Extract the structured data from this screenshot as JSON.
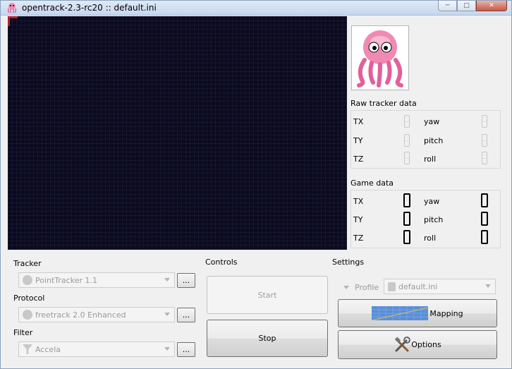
{
  "window": {
    "title": "opentrack-2.3-rc20 :: default.ini"
  },
  "raw_tracker": {
    "title": "Raw tracker data",
    "rows": [
      {
        "left_label": "TX",
        "right_label": "yaw"
      },
      {
        "left_label": "TY",
        "right_label": "pitch"
      },
      {
        "left_label": "TZ",
        "right_label": "roll"
      }
    ]
  },
  "game_data": {
    "title": "Game data",
    "rows": [
      {
        "left_label": "TX",
        "left_value": "0",
        "right_label": "yaw",
        "right_value": "0"
      },
      {
        "left_label": "TY",
        "left_value": "0",
        "right_label": "pitch",
        "right_value": "0"
      },
      {
        "left_label": "TZ",
        "left_value": "0",
        "right_label": "roll",
        "right_value": "0"
      }
    ]
  },
  "modules": {
    "tracker_label": "Tracker",
    "tracker_value": "PointTracker 1.1",
    "protocol_label": "Protocol",
    "protocol_value": "freetrack 2.0 Enhanced",
    "filter_label": "Filter",
    "filter_value": "Accela",
    "dots": "..."
  },
  "controls": {
    "title": "Controls",
    "start_label": "Start",
    "stop_label": "Stop"
  },
  "settings": {
    "title": "Settings",
    "profile_label": "Profile",
    "profile_value": "default.ini",
    "mapping_label": "Mapping",
    "options_label": "Options"
  },
  "colors": {
    "video_bg": "#0b0a1e",
    "octopus": "#f08ab4"
  },
  "icons": {
    "app": "octopus-icon",
    "tracker": "point-tracker-icon",
    "protocol": "freetrack-icon",
    "filter": "filter-icon",
    "profile": "profile-icon",
    "mapping": "curve-graph-icon",
    "options": "tools-icon"
  }
}
